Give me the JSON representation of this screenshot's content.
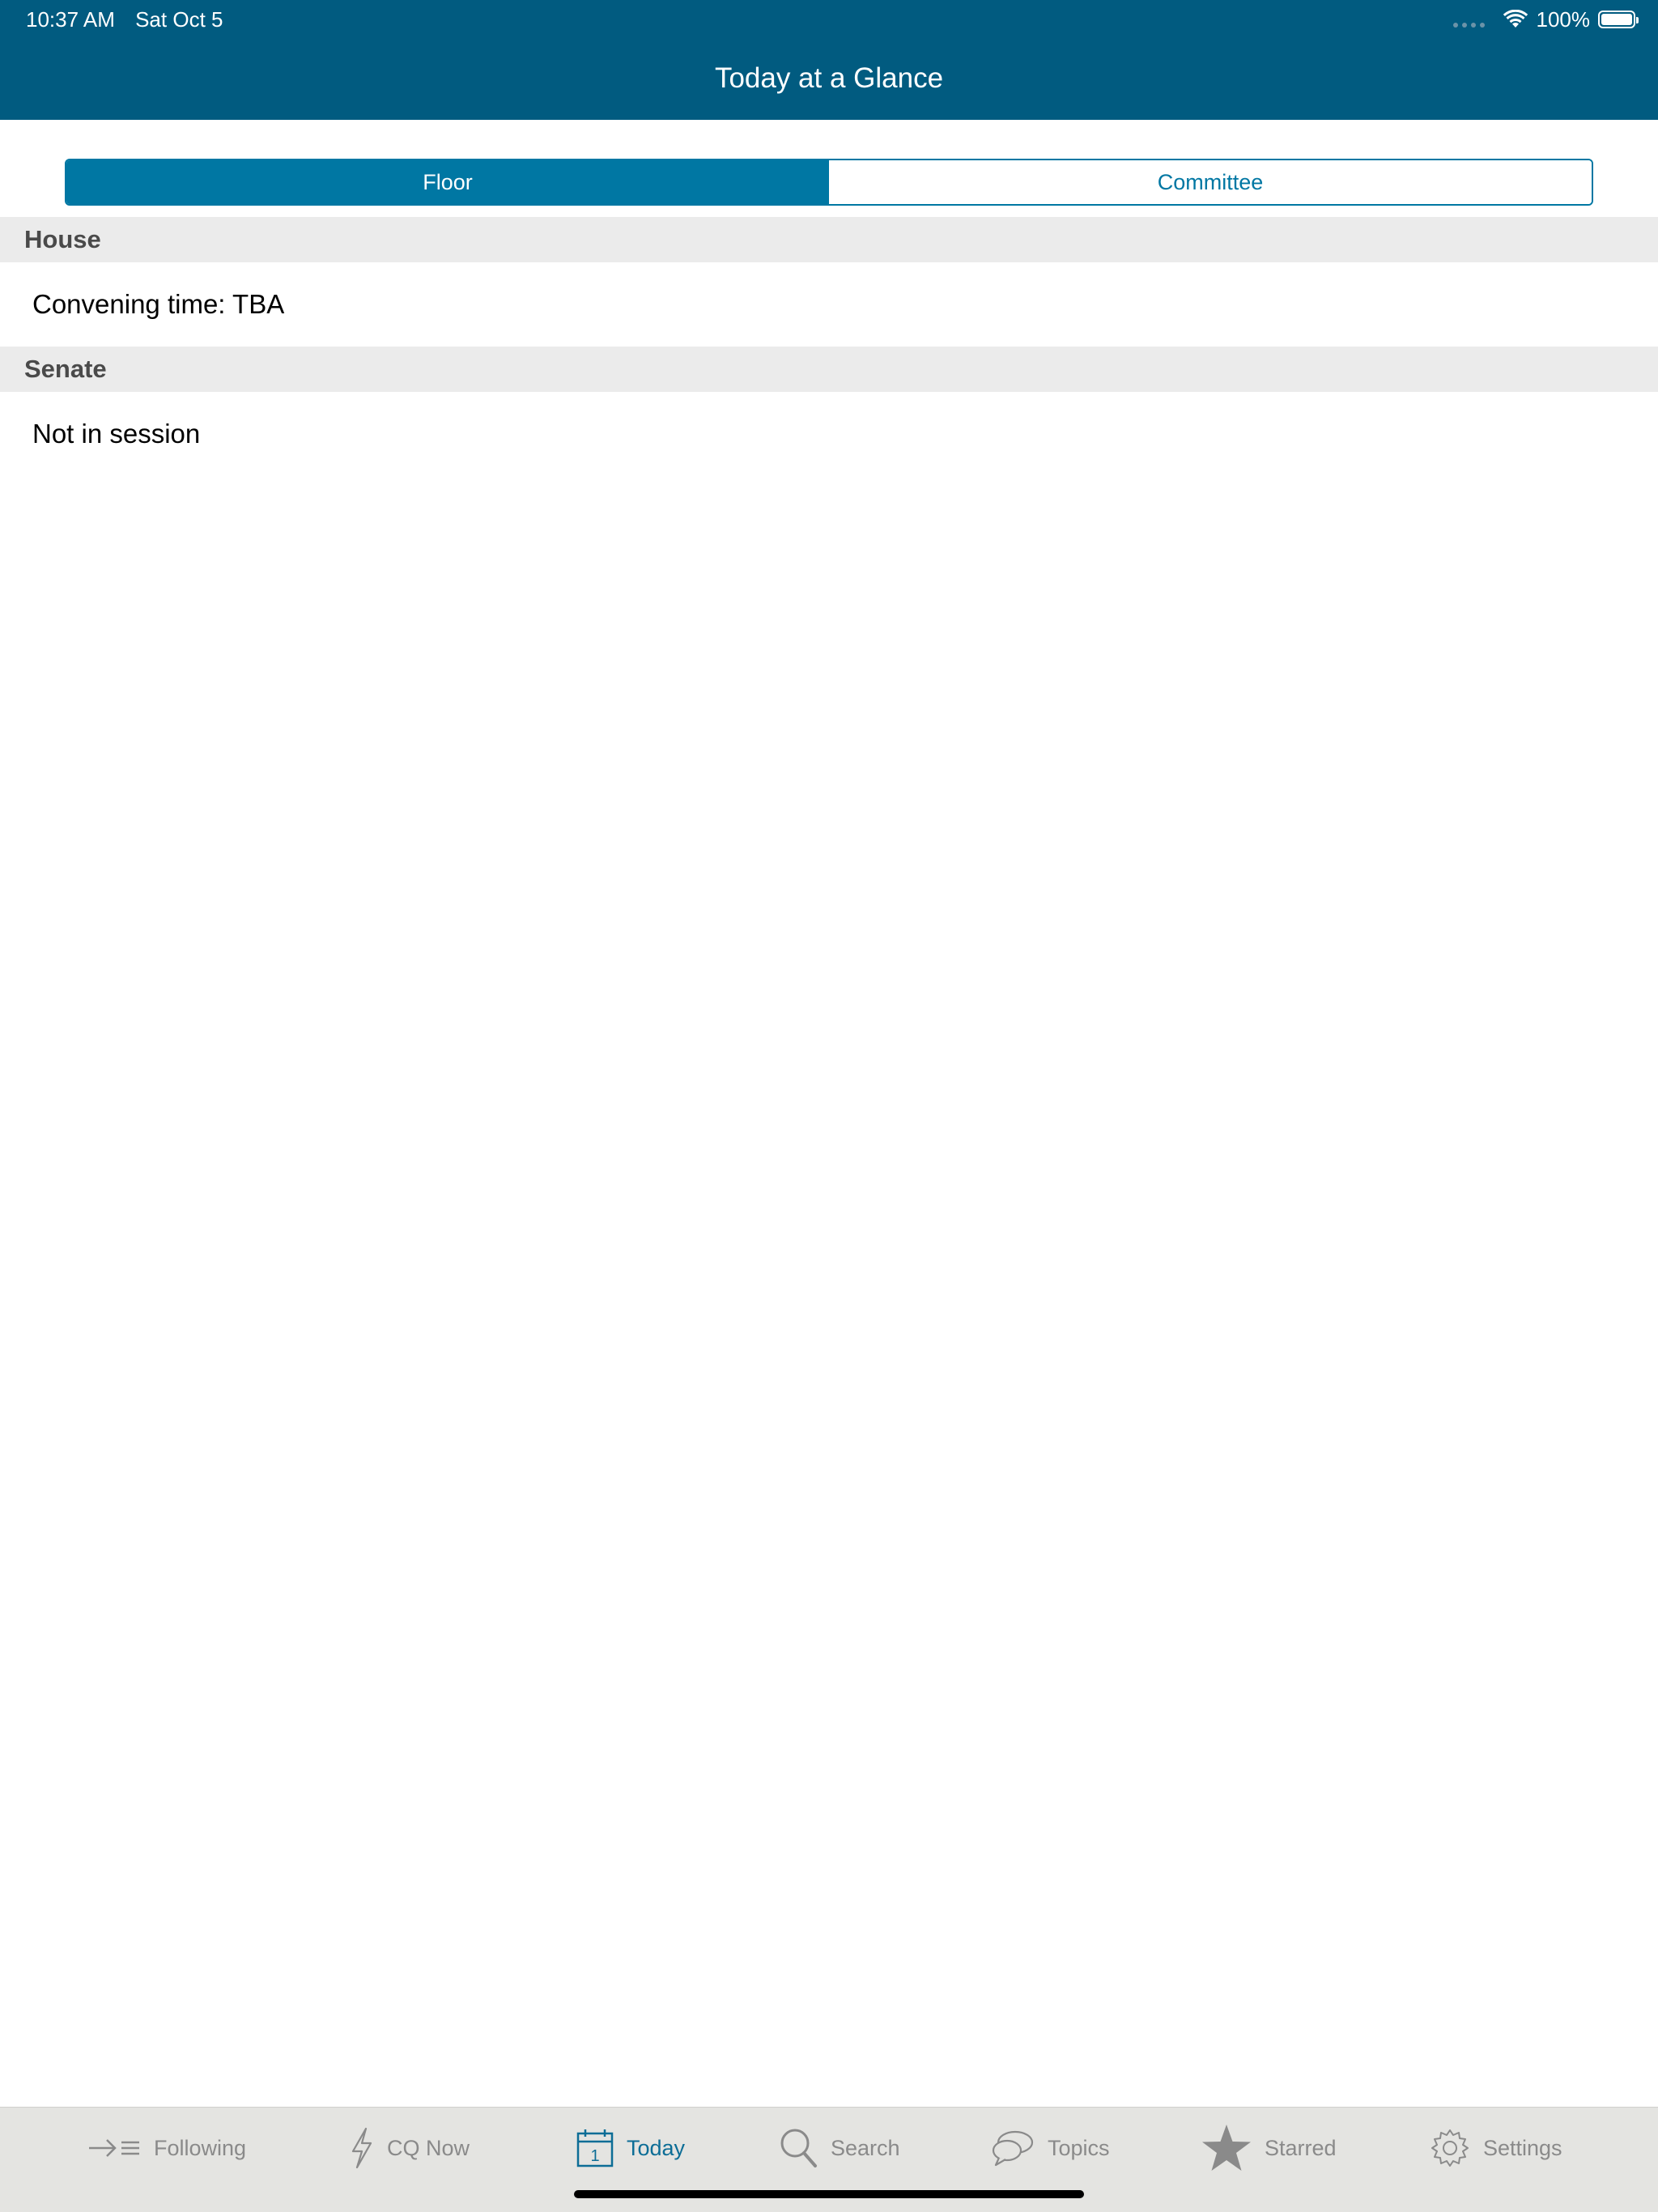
{
  "status_bar": {
    "time": "10:37 AM",
    "date": "Sat Oct 5",
    "battery": "100%",
    "battery_level": 1.0
  },
  "header": {
    "title": "Today at a Glance",
    "color": "#015b80"
  },
  "segmented": {
    "options": [
      "Floor",
      "Committee"
    ],
    "selected": "Floor",
    "accent": "#0077a3"
  },
  "sections": [
    {
      "title": "House",
      "rows": [
        "Convening time: TBA"
      ]
    },
    {
      "title": "Senate",
      "rows": [
        "Not in session"
      ]
    }
  ],
  "tabbar": {
    "active_color": "#0c6d96",
    "inactive_color": "#8a8a8a",
    "items": [
      {
        "label": "Following",
        "icon": "following-icon"
      },
      {
        "label": "CQ Now",
        "icon": "lightning-icon"
      },
      {
        "label": "Today",
        "icon": "calendar-icon",
        "icon_text": "1",
        "active": true
      },
      {
        "label": "Search",
        "icon": "search-icon"
      },
      {
        "label": "Topics",
        "icon": "chat-bubbles-icon"
      },
      {
        "label": "Starred",
        "icon": "star-icon"
      },
      {
        "label": "Settings",
        "icon": "gear-icon"
      }
    ]
  }
}
